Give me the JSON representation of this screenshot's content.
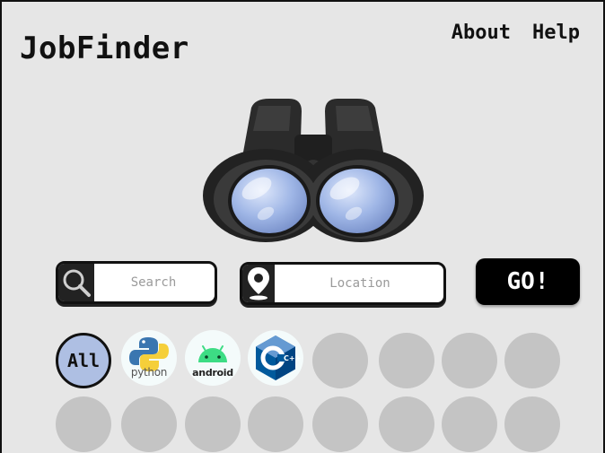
{
  "header": {
    "brand": "JobFinder",
    "nav": [
      {
        "label": "About"
      },
      {
        "label": "Help"
      }
    ]
  },
  "hero": {
    "icon": "binoculars-icon"
  },
  "search": {
    "placeholder": "Search",
    "icon": "magnifier-icon"
  },
  "location": {
    "placeholder": "Location",
    "icon": "map-pin-icon"
  },
  "go_button": {
    "label": "GO!"
  },
  "categories": {
    "items": [
      {
        "label": "All",
        "selected": true
      },
      {
        "label": "python",
        "icon": "python-logo-icon"
      },
      {
        "label": "android",
        "icon": "android-logo-icon"
      },
      {
        "label": "C++",
        "icon": "cpp-logo-icon"
      }
    ],
    "placeholder_count": 12
  },
  "colors": {
    "background": "#e6e6e6",
    "selected_category": "#aebfe3",
    "placeholder_circle": "#c4c4c4",
    "go_button": "#000000"
  }
}
